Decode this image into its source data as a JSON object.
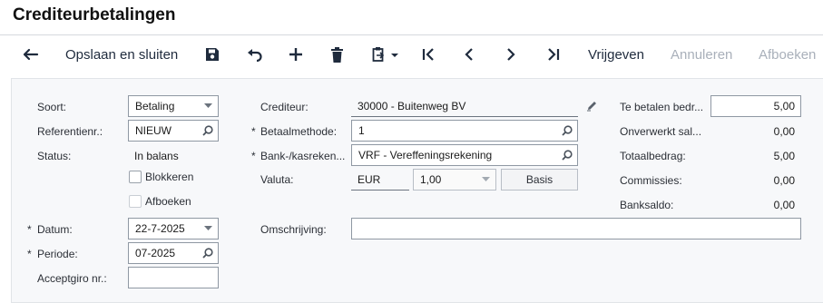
{
  "page": {
    "title": "Crediteurbetalingen"
  },
  "toolbar": {
    "back_icon": "arrow-left-icon",
    "save_close_label": "Opslaan en sluiten",
    "save_icon": "floppy-disk-icon",
    "undo_icon": "undo-icon",
    "add_icon": "plus-icon",
    "delete_icon": "trash-icon",
    "clipboard_icon": "clipboard-dropdown-icon",
    "first_icon": "first-record-icon",
    "prev_icon": "chevron-left-icon",
    "next_icon": "chevron-right-icon",
    "last_icon": "last-record-icon",
    "release_label": "Vrijgeven",
    "cancel_label": "Annuleren",
    "post_label": "Afboeken"
  },
  "form": {
    "soort": {
      "label": "Soort:",
      "value": "Betaling"
    },
    "referentie": {
      "label": "Referentienr.:",
      "value": "NIEUW"
    },
    "status": {
      "label": "Status:",
      "value": "In balans"
    },
    "blokkeren": {
      "label": "Blokkeren",
      "checked": false
    },
    "afboeken": {
      "label": "Afboeken",
      "checked": false
    },
    "datum": {
      "label": "Datum:",
      "value": "22-7-2025"
    },
    "periode": {
      "label": "Periode:",
      "value": "07-2025"
    },
    "acceptgiro": {
      "label": "Acceptgiro nr.:",
      "value": ""
    },
    "crediteur": {
      "label": "Crediteur:",
      "value": "30000 - Buitenweg BV"
    },
    "betaalmethode": {
      "label": "Betaalmethode:",
      "value": "1"
    },
    "bank": {
      "label": "Bank-/kasreken...",
      "value": "VRF - Vereffeningsrekening"
    },
    "valuta": {
      "label": "Valuta:",
      "code": "EUR",
      "rate": "1,00",
      "basis_label": "Basis"
    },
    "omschrijving": {
      "label": "Omschrijving:",
      "value": ""
    },
    "required_mark": "*"
  },
  "totals": {
    "te_betalen": {
      "label": "Te betalen bedr...",
      "value": "5,00"
    },
    "onverwerkt": {
      "label": "Onverwerkt sal...",
      "value": "0,00"
    },
    "totaalbedrag": {
      "label": "Totaalbedrag:",
      "value": "5,00"
    },
    "commissies": {
      "label": "Commissies:",
      "value": "0,00"
    },
    "banksaldo": {
      "label": "Banksaldo:",
      "value": "0,00"
    }
  }
}
